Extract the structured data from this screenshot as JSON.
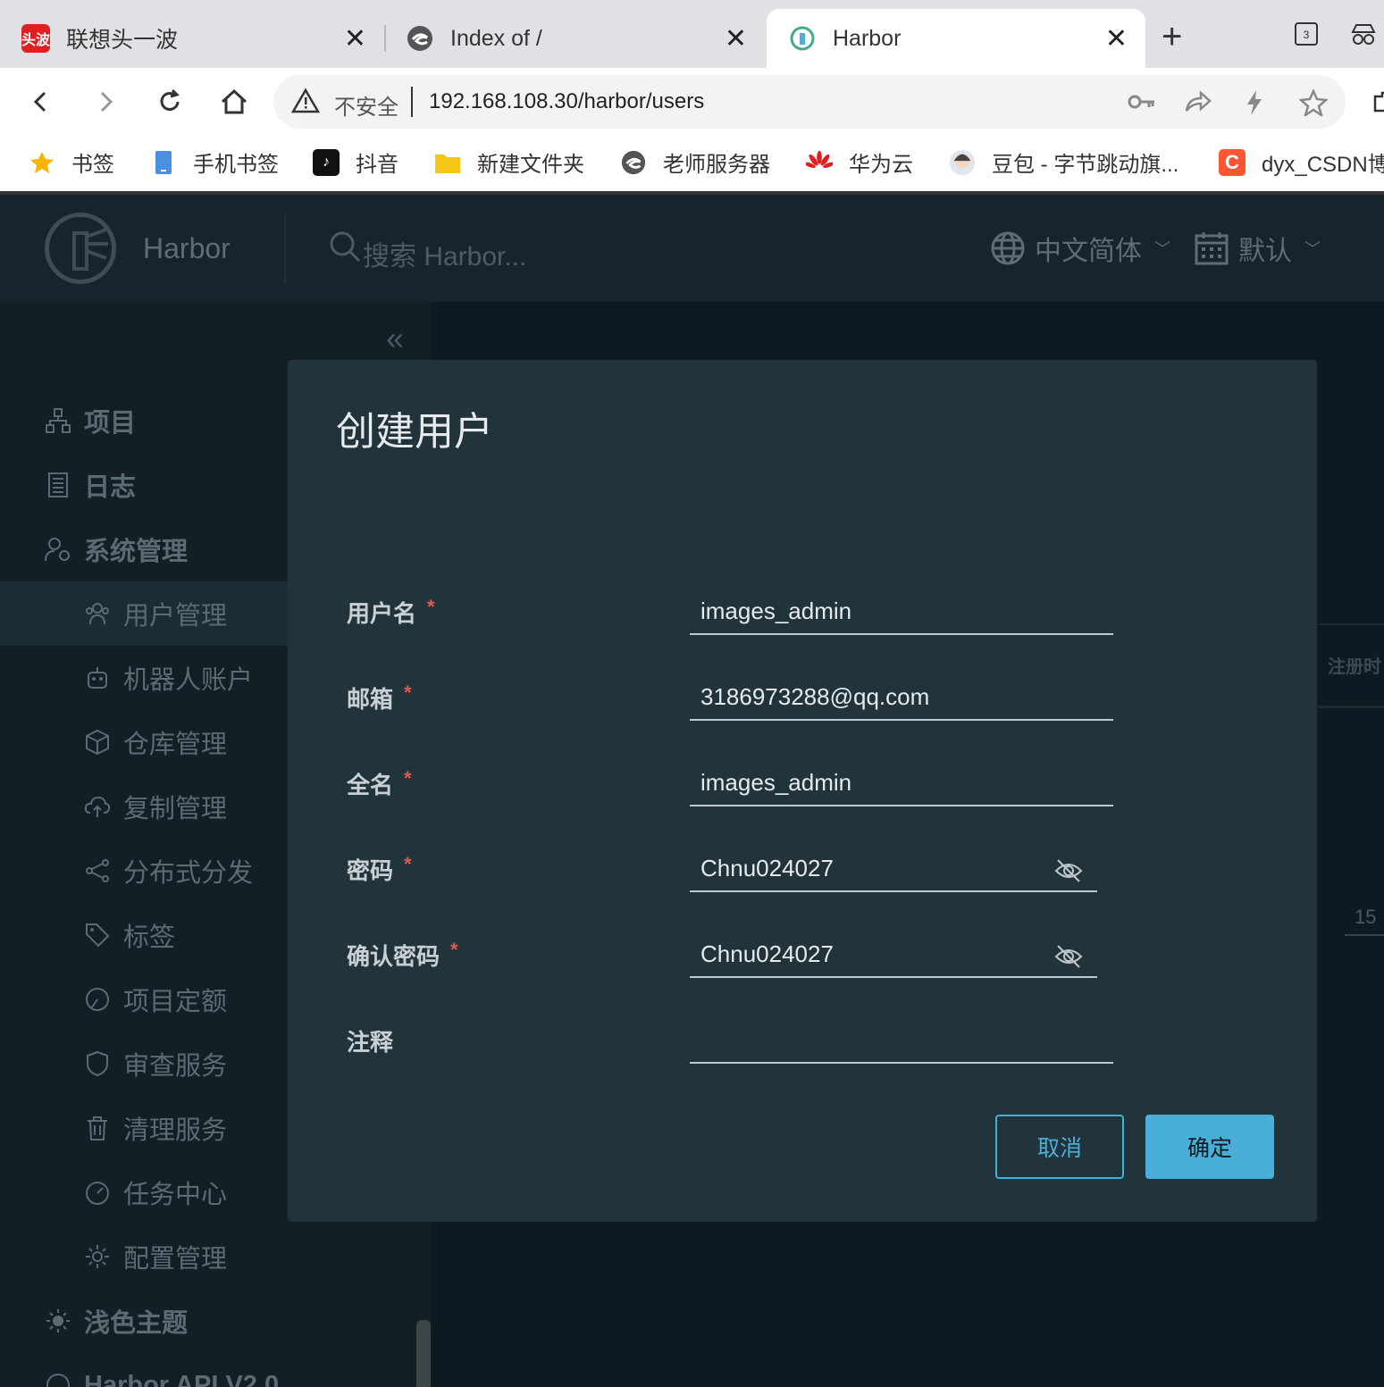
{
  "browser": {
    "tabs": [
      {
        "title": "联想头一波",
        "favicon": "news-icon",
        "favicon_text": "头波",
        "color": "#e02020"
      },
      {
        "title": "Index of /",
        "favicon": "edge-icon"
      },
      {
        "title": "Harbor",
        "favicon": "harbor-icon"
      }
    ],
    "tab_count": "3",
    "security_label": "不安全",
    "url": "192.168.108.30/harbor/users",
    "bookmarks": [
      {
        "label": "书签",
        "icon": "star-icon"
      },
      {
        "label": "手机书签",
        "icon": "phone-icon"
      },
      {
        "label": "抖音",
        "icon": "douyin-icon"
      },
      {
        "label": "新建文件夹",
        "icon": "folder-icon"
      },
      {
        "label": "老师服务器",
        "icon": "edge-icon"
      },
      {
        "label": "华为云",
        "icon": "huawei-icon"
      },
      {
        "label": "豆包 - 字节跳动旗...",
        "icon": "doubao-icon"
      },
      {
        "label": "dyx_CSDN博",
        "icon": "csdn-icon"
      }
    ]
  },
  "app": {
    "name": "Harbor",
    "search_placeholder": "搜索 Harbor...",
    "language": "中文简体",
    "schedule": "默认",
    "nav": [
      {
        "label": "项目",
        "icon": "projects-icon",
        "level": "top"
      },
      {
        "label": "日志",
        "icon": "logs-icon",
        "level": "top"
      },
      {
        "label": "系统管理",
        "icon": "admin-icon",
        "level": "top"
      },
      {
        "label": "用户管理",
        "icon": "users-icon",
        "level": "sub",
        "active": true
      },
      {
        "label": "机器人账户",
        "icon": "robot-icon",
        "level": "sub"
      },
      {
        "label": "仓库管理",
        "icon": "registry-icon",
        "level": "sub"
      },
      {
        "label": "复制管理",
        "icon": "replication-icon",
        "level": "sub"
      },
      {
        "label": "分布式分发",
        "icon": "share-icon",
        "level": "sub"
      },
      {
        "label": "标签",
        "icon": "tag-icon",
        "level": "sub"
      },
      {
        "label": "项目定额",
        "icon": "quota-icon",
        "level": "sub"
      },
      {
        "label": "审查服务",
        "icon": "shield-icon",
        "level": "sub"
      },
      {
        "label": "清理服务",
        "icon": "trash-icon",
        "level": "sub"
      },
      {
        "label": "任务中心",
        "icon": "dashboard-icon",
        "level": "sub"
      },
      {
        "label": "配置管理",
        "icon": "gear-icon",
        "level": "sub"
      },
      {
        "label": "浅色主题",
        "icon": "sun-icon",
        "level": "top"
      },
      {
        "label": "Harbor API V2.0",
        "icon": "api-icon",
        "level": "top"
      }
    ],
    "background": {
      "column_header": "注册时",
      "page_size": "15"
    }
  },
  "modal": {
    "title": "创建用户",
    "fields": {
      "username": {
        "label": "用户名",
        "value": "images_admin",
        "required": "*"
      },
      "email": {
        "label": "邮箱",
        "value": "3186973288@qq.com",
        "required": "*"
      },
      "fullname": {
        "label": "全名",
        "value": "images_admin",
        "required": "*"
      },
      "password": {
        "label": "密码",
        "value": "Chnu024027",
        "required": "*"
      },
      "confirm_password": {
        "label": "确认密码",
        "value": "Chnu024027",
        "required": "*"
      },
      "comment": {
        "label": "注释",
        "value": ""
      }
    },
    "cancel_label": "取消",
    "ok_label": "确定",
    "accent_color": "#49afd9"
  }
}
